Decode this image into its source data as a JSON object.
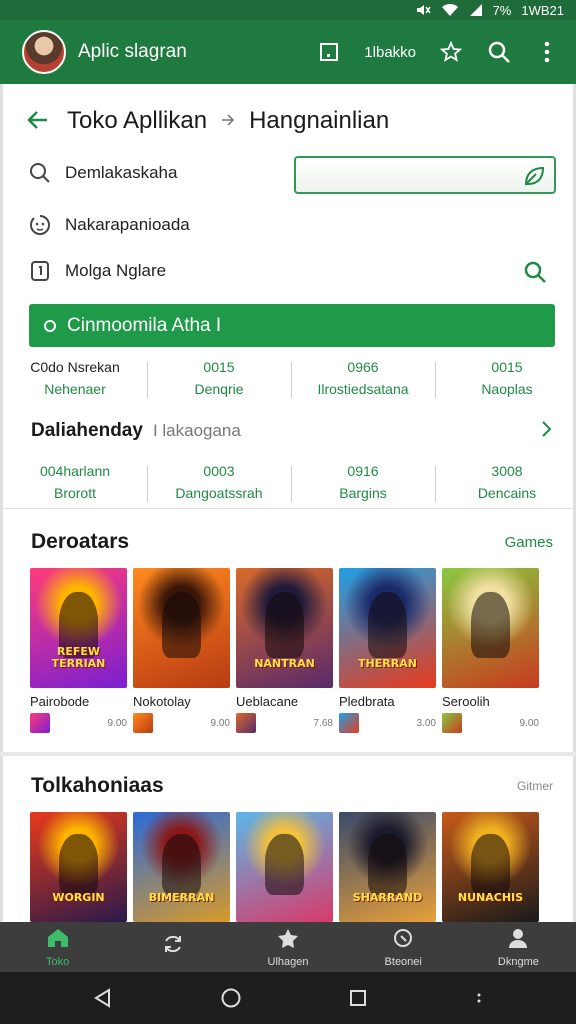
{
  "status": {
    "time": "1WB21",
    "battery": "7%"
  },
  "appbar": {
    "title": "Aplic slagran",
    "action_text": "1lbakko"
  },
  "breadcrumb": {
    "root": "Toko Apllikan",
    "current": "Hangnainlian"
  },
  "rows": [
    {
      "label": "Demlakaskaha",
      "icon": "search-icon"
    },
    {
      "label": "Nakarapanioada",
      "icon": "face-icon"
    },
    {
      "label": "Molga Nglare",
      "icon": "tag-icon"
    }
  ],
  "banner": {
    "label": "Cinmoomila Atha I"
  },
  "stats1": [
    {
      "value": "C0do Nsrekan",
      "label": "Nehenaer"
    },
    {
      "value": "0015",
      "label": "Denqrie"
    },
    {
      "value": "0966",
      "label": "Ilrostiedsatana"
    },
    {
      "value": "0015",
      "label": "Naoplas"
    }
  ],
  "subheader": {
    "bold": "Daliahenday",
    "muted": "I lakaogana"
  },
  "stats2": [
    {
      "value": "004harlann",
      "label": "Brorott"
    },
    {
      "value": "0003",
      "label": "Dangoatssrah"
    },
    {
      "value": "0916",
      "label": "Bargins"
    },
    {
      "value": "3008",
      "label": "Dencains"
    }
  ],
  "section1": {
    "title": "Deroatars",
    "link": "Games",
    "items": [
      {
        "name": "Pairobode",
        "meta": "9.00",
        "art_text": "REFEW TERRIAN",
        "colors": [
          "#ff3b7a",
          "#7a1fd1",
          "#ffb400"
        ]
      },
      {
        "name": "Nokotolay",
        "meta": "9.00",
        "art_text": "",
        "colors": [
          "#ff8a1f",
          "#b83a12",
          "#3a1608"
        ]
      },
      {
        "name": "Ueblacane",
        "meta": "7.68",
        "art_text": "NANTRAN",
        "colors": [
          "#d86a2a",
          "#5a2a6a",
          "#201a3a"
        ]
      },
      {
        "name": "Pledbrata",
        "meta": "3.00",
        "art_text": "THERRAN",
        "colors": [
          "#1fa0e8",
          "#e83a1a",
          "#1a2a6a"
        ]
      },
      {
        "name": "Seroolih",
        "meta": "9.00",
        "art_text": "",
        "colors": [
          "#8ac840",
          "#c83a1f",
          "#f0e0a0"
        ]
      }
    ]
  },
  "section2": {
    "title": "Tolkahoniaas",
    "link": "Gitmer",
    "items": [
      {
        "art_text": "WORGIN",
        "colors": [
          "#e83a1a",
          "#2a1a4a",
          "#ffb400"
        ]
      },
      {
        "art_text": "BIMERRAN",
        "colors": [
          "#2a6ad8",
          "#d89a2a",
          "#8a1a1a"
        ]
      },
      {
        "art_text": "",
        "colors": [
          "#5ab8e8",
          "#d83a6a",
          "#f0c040"
        ]
      },
      {
        "art_text": "SHARRAND",
        "colors": [
          "#3a4a6a",
          "#e8a03a",
          "#1a1a2a"
        ]
      },
      {
        "art_text": "NUNACHIS",
        "colors": [
          "#c85a1a",
          "#1a1a1a",
          "#f0b020"
        ]
      }
    ]
  },
  "bottomnav": [
    {
      "label": "Toko",
      "icon": "home-icon",
      "active": true
    },
    {
      "label": "",
      "icon": "refresh-icon",
      "active": false
    },
    {
      "label": "Ulhagen",
      "icon": "puzzle-icon",
      "active": false
    },
    {
      "label": "Bteonei",
      "icon": "search-icon",
      "active": false
    },
    {
      "label": "Dkngme",
      "icon": "person-icon",
      "active": false
    }
  ],
  "accent": "#1f8a45"
}
